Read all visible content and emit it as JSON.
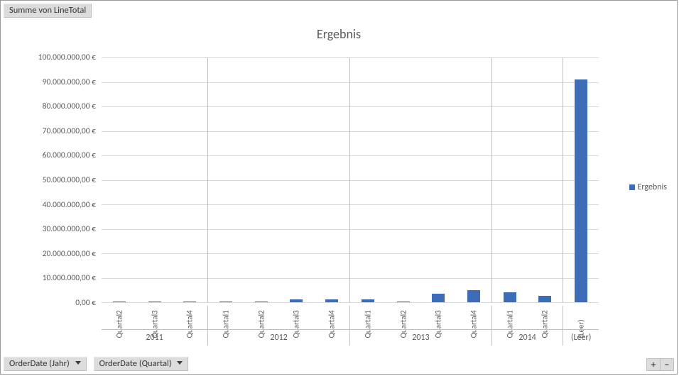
{
  "field_label": "Summe von LineTotal",
  "filters": {
    "year": "OrderDate (Jahr)",
    "quarter": "OrderDate (Quartal)"
  },
  "zoom": {
    "in": "+",
    "out": "−"
  },
  "legend": "Ergebnis",
  "series_color": "#3d6db7",
  "chart_data": {
    "type": "bar",
    "title": "Ergebnis",
    "ylabel": "",
    "ylim": [
      0,
      100000000
    ],
    "yticks": [
      0,
      10000000,
      20000000,
      30000000,
      40000000,
      50000000,
      60000000,
      70000000,
      80000000,
      90000000,
      100000000
    ],
    "ytick_labels": [
      "0,00 €",
      "10.000.000,00 €",
      "20.000.000,00 €",
      "30.000.000,00 €",
      "40.000.000,00 €",
      "50.000.000,00 €",
      "60.000.000,00 €",
      "70.000.000,00 €",
      "80.000.000,00 €",
      "90.000.000,00 €",
      "100.000.000,00 €"
    ],
    "series": [
      {
        "name": "Ergebnis",
        "values": [
          150000,
          150000,
          150000,
          150000,
          150000,
          1200000,
          1200000,
          1200000,
          150000,
          3500000,
          5000000,
          4000000,
          2500000,
          91000000
        ]
      }
    ],
    "categories": [
      "Quartal2",
      "Quartal3",
      "Quartal4",
      "Quartal1",
      "Quartal2",
      "Quartal3",
      "Quartal4",
      "Quartal1",
      "Quartal2",
      "Quartal3",
      "Quartal4",
      "Quartal1",
      "Quartal2",
      "(Leer)"
    ],
    "category_groups": [
      {
        "label": "2011",
        "span": 3
      },
      {
        "label": "2012",
        "span": 4
      },
      {
        "label": "2013",
        "span": 4
      },
      {
        "label": "2014",
        "span": 2
      },
      {
        "label": "(Leer)",
        "span": 1
      }
    ]
  }
}
